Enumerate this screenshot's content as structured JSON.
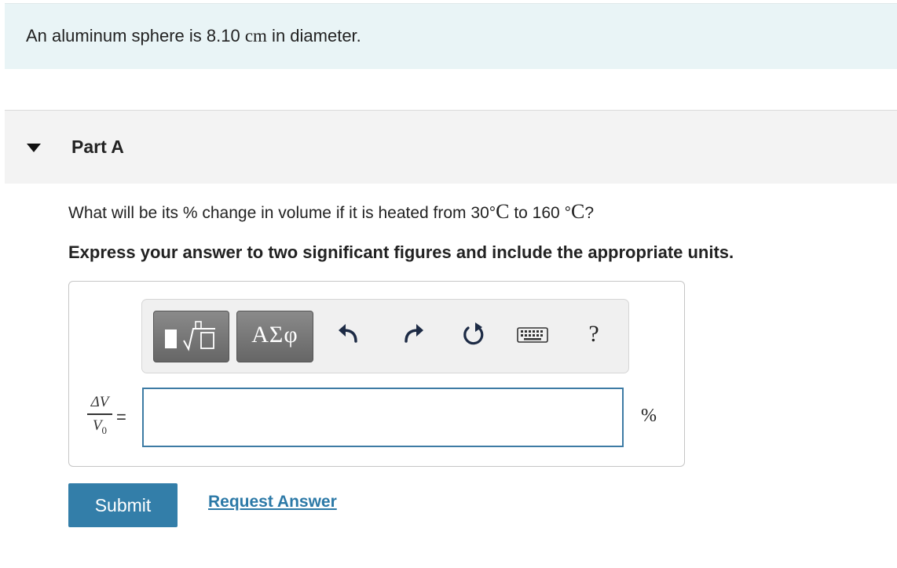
{
  "intro": {
    "text_prefix": "An aluminum sphere is 8.10 ",
    "unit": "cm",
    "text_suffix": " in diameter."
  },
  "part": {
    "title": "Part A"
  },
  "question": {
    "prefix": "What will be its % change in volume if it is heated from 30",
    "deg1": "°",
    "unit1": "C",
    "middle": " to 160 ",
    "deg2": "°",
    "unit2": "C",
    "suffix": "?"
  },
  "instructions": "Express your answer to two significant figures and include the appropriate units.",
  "toolbar": {
    "symbols_label": "ΑΣφ",
    "help_label": "?"
  },
  "answer": {
    "numerator": "ΔV",
    "denominator": "V",
    "denominator_sub": "0",
    "equals": "=",
    "value": "",
    "unit": "%"
  },
  "actions": {
    "submit_label": "Submit",
    "request_label": "Request Answer"
  },
  "colors": {
    "intro_bg": "#e9f4f6",
    "accent": "#337ea9",
    "link": "#2c79a7",
    "input_border": "#3d7ba4"
  },
  "icons": [
    "templates-icon",
    "undo-icon",
    "redo-icon",
    "reset-icon",
    "keyboard-icon",
    "help-icon"
  ]
}
